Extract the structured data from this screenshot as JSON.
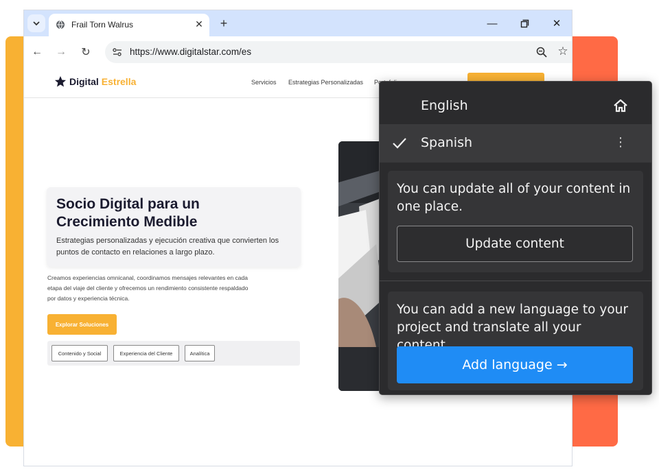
{
  "colors": {
    "accent_left": "#f8b133",
    "accent_right": "#ff6a45",
    "tab_strip": "#d3e3fd",
    "brand_yellow": "#f8b133",
    "panel_bg": "#2b2b2d",
    "add_button": "#1f8cf5"
  },
  "browser": {
    "tab_title": "Frail Torn Walrus",
    "url": "https://www.digitalstar.com/es",
    "icons": [
      "tab-search-icon",
      "globe-icon",
      "close-icon",
      "plus-icon",
      "minimize-icon",
      "restore-icon",
      "window-close-icon",
      "back-icon",
      "forward-icon",
      "reload-icon",
      "site-info-icon",
      "zoom-icon",
      "star-icon"
    ]
  },
  "site": {
    "logo_part1": "Digital",
    "logo_part2": "Estrella",
    "nav": [
      "Servicios",
      "Estrategias Personalizadas",
      "Portafolio"
    ],
    "hero_title": "Socio Digital para un Crecimiento Medible",
    "hero_subtitle": "Estrategias personalizadas y ejecución creativa que convierten los puntos de contacto en relaciones a largo plazo.",
    "hero_body": "Creamos experiencias omnicanal, coordinamos mensajes relevantes en cada etapa del viaje del cliente y ofrecemos un rendimiento consistente respaldado por datos y experiencia técnica.",
    "explore_button": "Explorar Soluciones",
    "tags": [
      "Contenido y Social",
      "Experiencia del Cliente",
      "Analítica"
    ]
  },
  "panel": {
    "lang_english": "English",
    "lang_spanish": "Spanish",
    "update_text": "You can update all of your content in one place.",
    "update_button": "Update content",
    "add_text": "You can add a new language to your project and translate all your content.",
    "add_button": "Add language →"
  }
}
